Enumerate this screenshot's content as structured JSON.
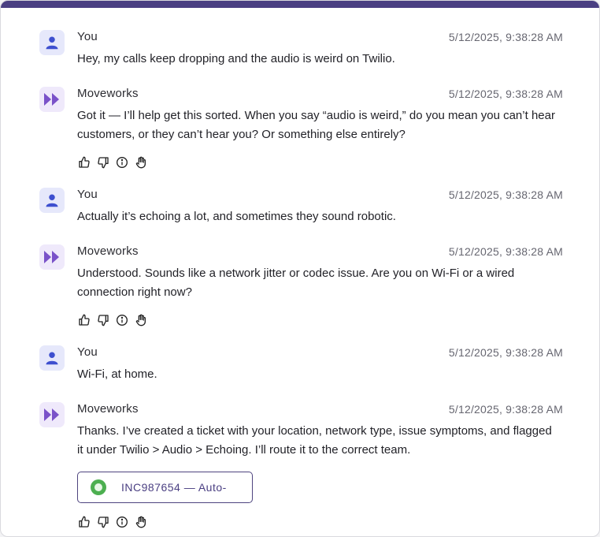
{
  "messages": [
    {
      "sender": "You",
      "role": "user",
      "time": "5/12/2025, 9:38:28 AM",
      "text": "Hey, my calls keep dropping and the audio is weird on Twilio."
    },
    {
      "sender": "Moveworks",
      "role": "bot",
      "time": "5/12/2025, 9:38:28 AM",
      "text": "Got it — I’ll help get this sorted. When you say “audio is weird,” do you mean you can’t hear customers, or they can’t hear you? Or something else entirely?"
    },
    {
      "sender": "You",
      "role": "user",
      "time": "5/12/2025, 9:38:28 AM",
      "text": "Actually it’s echoing a lot, and sometimes they sound robotic."
    },
    {
      "sender": "Moveworks",
      "role": "bot",
      "time": "5/12/2025, 9:38:28 AM",
      "text": "Understood. Sounds like a network jitter or codec issue. Are you on Wi-Fi or a wired connection right now?"
    },
    {
      "sender": "You",
      "role": "user",
      "time": "5/12/2025, 9:38:28 AM",
      "text": "Wi-Fi, at home."
    },
    {
      "sender": "Moveworks",
      "role": "bot",
      "time": "5/12/2025, 9:38:28 AM",
      "text": "Thanks. I’ve created a ticket with your location, network type, issue symptoms, and flagged it under Twilio > Audio > Echoing. I’ll route it to the correct team.",
      "ticket_label": "INC987654 — Auto-"
    }
  ],
  "colors": {
    "accent": "#4a3f82",
    "user_icon": "#3d4fcf",
    "bot_icon": "#7a52c9",
    "ticket_status": "#4caf50"
  },
  "icons": {
    "user": "person-icon",
    "bot": "moveworks-logo-icon",
    "actions": [
      "thumbs-up-icon",
      "thumbs-down-icon",
      "info-icon",
      "hand-raise-icon"
    ]
  }
}
